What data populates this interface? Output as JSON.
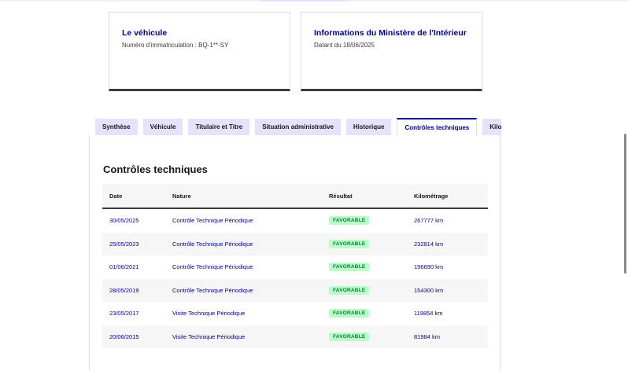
{
  "cards": [
    {
      "title": "Le véhicule",
      "text": "Numéro d'immatriculation : BQ-1**-SY"
    },
    {
      "title": "Informations du Ministère de l'Intérieur",
      "text": "Datant du 18/06/2025"
    }
  ],
  "tabs": [
    "Synthèse",
    "Véhicule",
    "Titulaire et Titre",
    "Situation administrative",
    "Historique",
    "Contrôles techniques",
    "Kilométrage"
  ],
  "active_tab": "Contrôles techniques",
  "section_title": "Contrôles techniques",
  "table": {
    "headers": [
      "Date",
      "Nature",
      "Résultat",
      "Kilométrage"
    ],
    "rows": [
      [
        "30/05/2025",
        "Contrôle Technique Périodique",
        "FAVORABLE",
        "267777 km"
      ],
      [
        "25/05/2023",
        "Contrôle Technique Périodique",
        "FAVORABLE",
        "232814 km"
      ],
      [
        "01/06/2021",
        "Contrôle Technique Périodique",
        "FAVORABLE",
        "196690 km"
      ],
      [
        "28/05/2019",
        "Contrôle Technique Périodique",
        "FAVORABLE",
        "154300 km"
      ],
      [
        "23/05/2017",
        "Visite Technique Périodique",
        "FAVORABLE",
        "119854 km"
      ],
      [
        "20/06/2015",
        "Visite Technique Périodique",
        "FAVORABLE",
        "81984 km"
      ]
    ]
  },
  "colors": {
    "accent": "#000091",
    "badge_bg": "#b8fec9",
    "badge_text": "#18753c",
    "tab_bg": "#e3e3fd"
  }
}
